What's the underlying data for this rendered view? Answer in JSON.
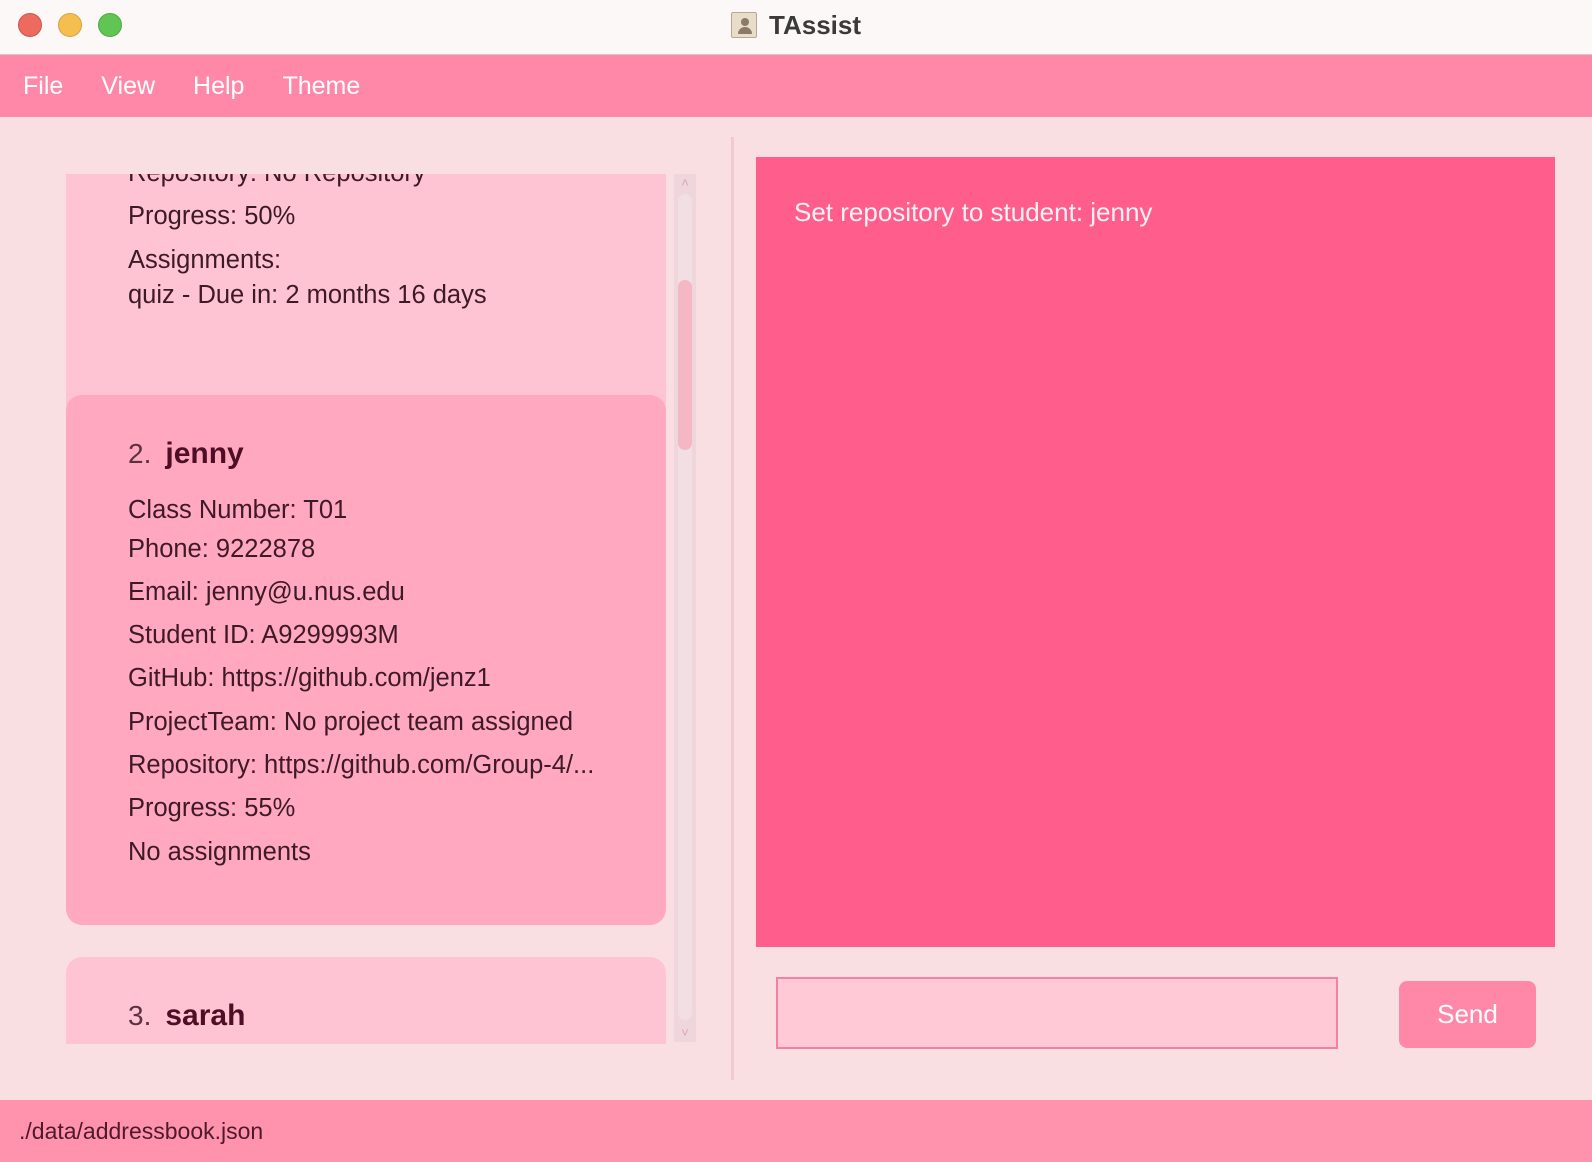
{
  "window": {
    "title": "TAssist",
    "app_icon": "address-book-icon"
  },
  "menu": {
    "items": [
      "File",
      "View",
      "Help",
      "Theme"
    ]
  },
  "student_list": {
    "cards": [
      {
        "fields": {
          "repository": "Repository: No Repository",
          "progress": "Progress: 50%",
          "assignments_label": "Assignments:",
          "assignment_1": "quiz - Due in: 2 months 16 days"
        }
      },
      {
        "index": "2.",
        "name": "jenny",
        "fields": {
          "class_number": "Class Number: T01",
          "phone": "Phone: 9222878",
          "email": "Email: jenny@u.nus.edu",
          "student_id": "Student ID: A9299993M",
          "github": "GitHub: https://github.com/jenz1",
          "project_team": "ProjectTeam: No project team assigned",
          "repository": "Repository: https://github.com/Group-4/...",
          "progress": "Progress: 55%",
          "assignments": "No assignments"
        }
      },
      {
        "index": "3.",
        "name": "sarah"
      }
    ]
  },
  "result": {
    "message": "Set repository to student: jenny"
  },
  "command": {
    "value": "",
    "send_label": "Send"
  },
  "status": {
    "path": "./data/addressbook.json"
  },
  "colors": {
    "menu_bar": "#ff88a8",
    "result_box": "#ff5d8c",
    "card_selected": "#ffa8c0",
    "card": "#ffc4d4",
    "background": "#fadfe2"
  }
}
